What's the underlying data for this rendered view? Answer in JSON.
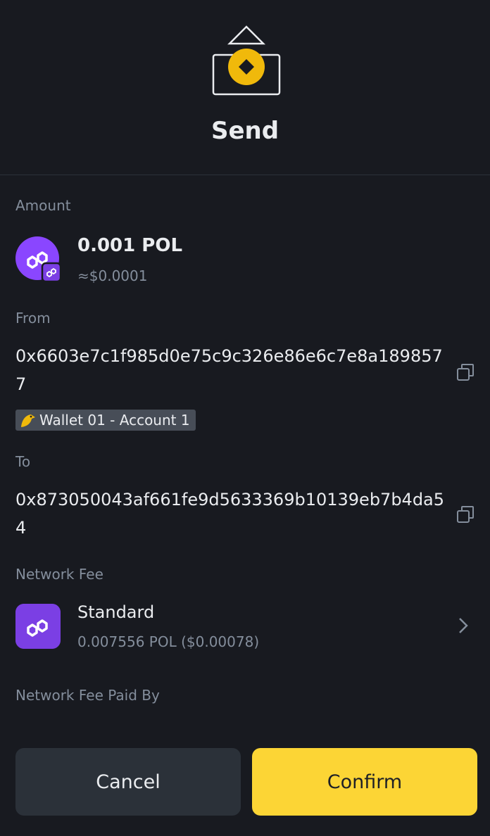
{
  "header": {
    "title": "Send",
    "icon": "send-icon"
  },
  "amount": {
    "label": "Amount",
    "value": "0.001 POL",
    "fiat": "≈$0.0001",
    "token_icon": "polygon-token-icon"
  },
  "from": {
    "label": "From",
    "address": "0x6603e7c1f985d0e75c9c326e86e6c7e8a1898577",
    "wallet_tag": "Wallet 01 - Account 1",
    "copy_icon": "copy-icon"
  },
  "to": {
    "label": "To",
    "address": "0x873050043af661fe9d5633369b10139eb7b4da54",
    "copy_icon": "copy-icon"
  },
  "network_fee": {
    "label": "Network Fee",
    "level": "Standard",
    "detail": "0.007556 POL ($0.00078)"
  },
  "fee_paid_by": {
    "label": "Network Fee Paid By"
  },
  "buttons": {
    "cancel": "Cancel",
    "confirm": "Confirm"
  },
  "colors": {
    "background": "#181a20",
    "accent": "#fcd535",
    "polygon_purple": "#7b3fe4",
    "muted_text": "#848e9c"
  }
}
